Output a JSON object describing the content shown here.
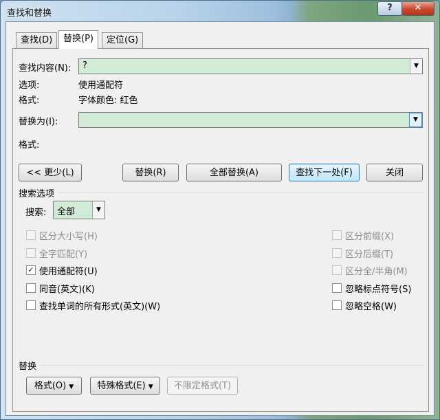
{
  "window": {
    "title": "查找和替换",
    "help_label": "?",
    "close_label": "✕"
  },
  "tabs": [
    {
      "label": "查找(D)",
      "active": false
    },
    {
      "label": "替换(P)",
      "active": true
    },
    {
      "label": "定位(G)",
      "active": false
    }
  ],
  "find": {
    "label": "查找内容(N):",
    "value": "?",
    "options_label": "选项:",
    "options_value": "使用通配符",
    "format_label": "格式:",
    "format_value": "字体颜色: 红色"
  },
  "replace": {
    "label": "替换为(I):",
    "value": "",
    "format_label": "格式:"
  },
  "buttons": {
    "less": "<< 更少(L)",
    "replace": "替换(R)",
    "replace_all": "全部替换(A)",
    "find_next": "查找下一处(F)",
    "close": "关闭"
  },
  "search_options": {
    "title": "搜索选项",
    "search_label": "搜索:",
    "search_value": "全部"
  },
  "checkboxes_left": [
    {
      "label": "区分大小写(H)",
      "checked": false,
      "disabled": true
    },
    {
      "label": "全字匹配(Y)",
      "checked": false,
      "disabled": true
    },
    {
      "label": "使用通配符(U)",
      "checked": true,
      "disabled": false
    },
    {
      "label": "同音(英文)(K)",
      "checked": false,
      "disabled": false
    },
    {
      "label": "查找单词的所有形式(英文)(W)",
      "checked": false,
      "disabled": false
    }
  ],
  "checkboxes_right": [
    {
      "label": "区分前缀(X)",
      "checked": false,
      "disabled": true
    },
    {
      "label": "区分后缀(T)",
      "checked": false,
      "disabled": true
    },
    {
      "label": "区分全/半角(M)",
      "checked": false,
      "disabled": true
    },
    {
      "label": "忽略标点符号(S)",
      "checked": false,
      "disabled": false
    },
    {
      "label": "忽略空格(W)",
      "checked": false,
      "disabled": false
    }
  ],
  "replace_section": {
    "title": "替换",
    "format_button": "格式(O)",
    "special_button": "特殊格式(E)",
    "no_format_button": "不限定格式(T)"
  },
  "colors": {
    "field_bg": "#d2ebd6",
    "titlebar_close": "#c8462b"
  }
}
